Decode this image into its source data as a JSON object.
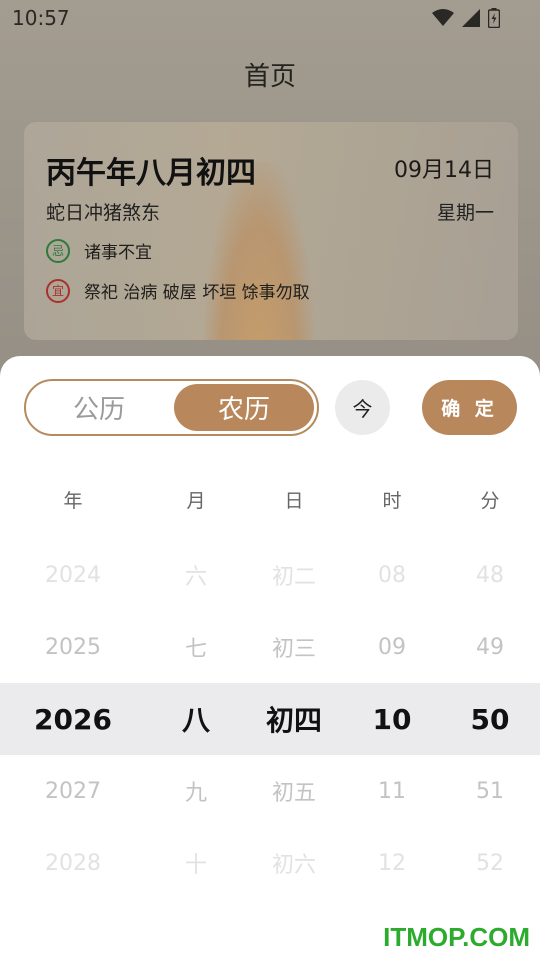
{
  "status_bar": {
    "time": "10:57",
    "icons": [
      "wifi-icon",
      "cell-signal-icon",
      "battery-icon"
    ]
  },
  "page": {
    "title": "首页"
  },
  "card": {
    "lunar_date": "丙午年八月初四",
    "solar_date": "09月14日",
    "ganzhi": "蛇日冲猪煞东",
    "weekday": "星期一",
    "ji_badge": "忌",
    "ji_text": "诸事不宜",
    "yi_badge": "宜",
    "yi_text": "祭祀 治病 破屋 坏垣 馀事勿取"
  },
  "sheet": {
    "calendar_type": {
      "solar": "公历",
      "lunar": "农历",
      "selected": "农历"
    },
    "today_label": "今",
    "confirm_label": "确 定",
    "columns": {
      "year": {
        "header": "年",
        "values": [
          "2024",
          "2025",
          "2026",
          "2027",
          "2028"
        ]
      },
      "month": {
        "header": "月",
        "values": [
          "六",
          "七",
          "八",
          "九",
          "十"
        ]
      },
      "day": {
        "header": "日",
        "values": [
          "初二",
          "初三",
          "初四",
          "初五",
          "初六"
        ]
      },
      "hour": {
        "header": "时",
        "values": [
          "08",
          "09",
          "10",
          "11",
          "12"
        ]
      },
      "minute": {
        "header": "分",
        "values": [
          "48",
          "49",
          "50",
          "51",
          "52"
        ]
      }
    }
  },
  "watermark": "ITMOP.COM",
  "colors": {
    "accent": "#b8875b",
    "ji": "#2d7a3c",
    "yi": "#a9312a",
    "watermark": "#2cab2c"
  }
}
